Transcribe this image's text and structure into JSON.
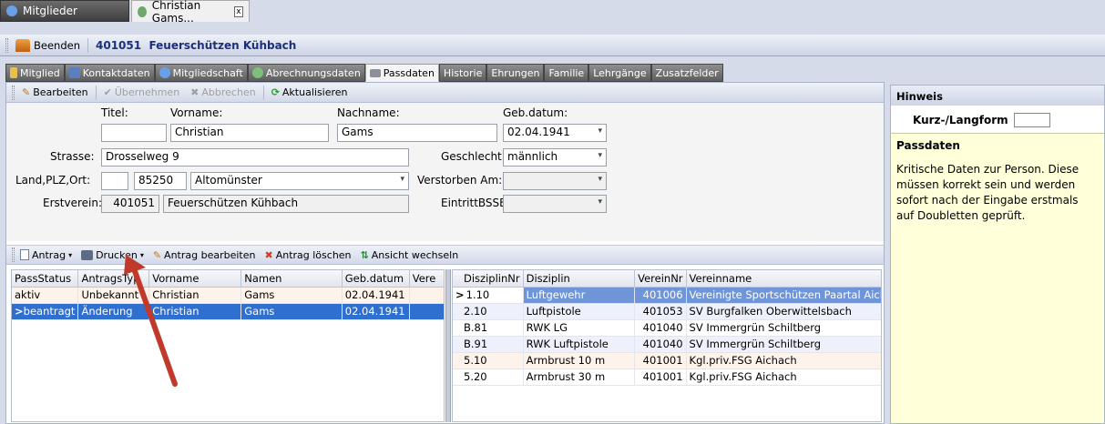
{
  "window_tabs": [
    {
      "label": "Mitglieder",
      "icon": "members-icon"
    },
    {
      "label": "Christian Gams...",
      "icon": "person-icon",
      "close": "x"
    }
  ],
  "header": {
    "exit_label": "Beenden",
    "title": "401051  Feuerschützen Kühbach"
  },
  "main_tabs": [
    {
      "label": "Mitglied",
      "active": false
    },
    {
      "label": "Kontaktdaten",
      "active": false
    },
    {
      "label": "Mitgliedschaft",
      "active": false
    },
    {
      "label": "Abrechnungsdaten",
      "active": false
    },
    {
      "label": "Passdaten",
      "active": true
    },
    {
      "label": "Historie",
      "active": false
    },
    {
      "label": "Ehrungen",
      "active": false
    },
    {
      "label": "Familie",
      "active": false
    },
    {
      "label": "Lehrgänge",
      "active": false
    },
    {
      "label": "Zusatzfelder",
      "active": false
    }
  ],
  "edit_toolbar": {
    "edit": "Bearbeiten",
    "apply": "Übernehmen",
    "cancel": "Abbrechen",
    "refresh": "Aktualisieren"
  },
  "form": {
    "title_label": "Titel:",
    "title_value": "",
    "firstname_label": "Vorname:",
    "firstname_value": "Christian",
    "lastname_label": "Nachname:",
    "lastname_value": "Gams",
    "birthdate_label": "Geb.datum:",
    "birthdate_value": "02.04.1941",
    "street_label": "Strasse:",
    "street_value": "Drosselweg 9",
    "gender_label": "Geschlecht:",
    "gender_value": "männlich",
    "location_label": "Land,PLZ,Ort:",
    "country_value": "",
    "zip_value": "85250",
    "city_value": "Altomünster",
    "deceased_label": "Verstorben Am:",
    "deceased_value": "",
    "firstclub_label": "Erstverein:",
    "firstclub_nr": "401051",
    "firstclub_name": "Feuerschützen Kühbach",
    "bssb_label": "EintrittBSSB:",
    "bssb_value": ""
  },
  "pass_toolbar": {
    "application": "Antrag",
    "print": "Drucken",
    "edit_application": "Antrag bearbeiten",
    "delete_application": "Antrag löschen",
    "switch_view": "Ansicht wechseln"
  },
  "pass_grid": {
    "columns": [
      "PassStatus",
      "AntragsTyp",
      "Vorname",
      "Namen",
      "Geb.datum",
      "Vere"
    ],
    "rows": [
      {
        "cells": [
          "aktiv",
          "Unbekannt",
          "Christian",
          "Gams",
          "02.04.1941",
          ""
        ],
        "marker": "",
        "selected": false
      },
      {
        "cells": [
          "beantragt",
          "Änderung",
          "Christian",
          "Gams",
          "02.04.1941",
          ""
        ],
        "marker": ">",
        "selected": true
      }
    ]
  },
  "disc_grid": {
    "columns": [
      "DisziplinNr",
      "Disziplin",
      "VereinNr",
      "Vereinname"
    ],
    "rows": [
      {
        "cells": [
          "1.10",
          "Luftgewehr",
          "401006",
          "Vereinigte Sportschützen Paartal Aich"
        ],
        "marker": ">",
        "selected": true
      },
      {
        "cells": [
          "2.10",
          "Luftpistole",
          "401053",
          "SV Burgfalken Oberwittelsbach"
        ],
        "marker": "",
        "selected": false
      },
      {
        "cells": [
          "B.81",
          "RWK LG",
          "401040",
          "SV Immergrün Schiltberg"
        ],
        "marker": "",
        "selected": false
      },
      {
        "cells": [
          "B.91",
          "RWK Luftpistole",
          "401040",
          "SV Immergrün Schiltberg"
        ],
        "marker": "",
        "selected": false
      },
      {
        "cells": [
          "5.10",
          "Armbrust 10 m",
          "401001",
          "Kgl.priv.FSG Aichach"
        ],
        "marker": "",
        "selected": false
      },
      {
        "cells": [
          "5.20",
          "Armbrust 30 m",
          "401001",
          "Kgl.priv.FSG Aichach"
        ],
        "marker": "",
        "selected": false
      }
    ]
  },
  "hint": {
    "header": "Hinweis",
    "toggle_label": "Kurz-/Langform",
    "title": "Passdaten",
    "text": "Kritische Daten zur Person. Diese müssen korrekt sein und werden sofort nach der Eingabe erstmals auf Doubletten geprüft."
  },
  "colors": {
    "selection": "#2f6fcf",
    "annotation_arrow": "#c0392b",
    "hint_background": "#ffffd9"
  }
}
